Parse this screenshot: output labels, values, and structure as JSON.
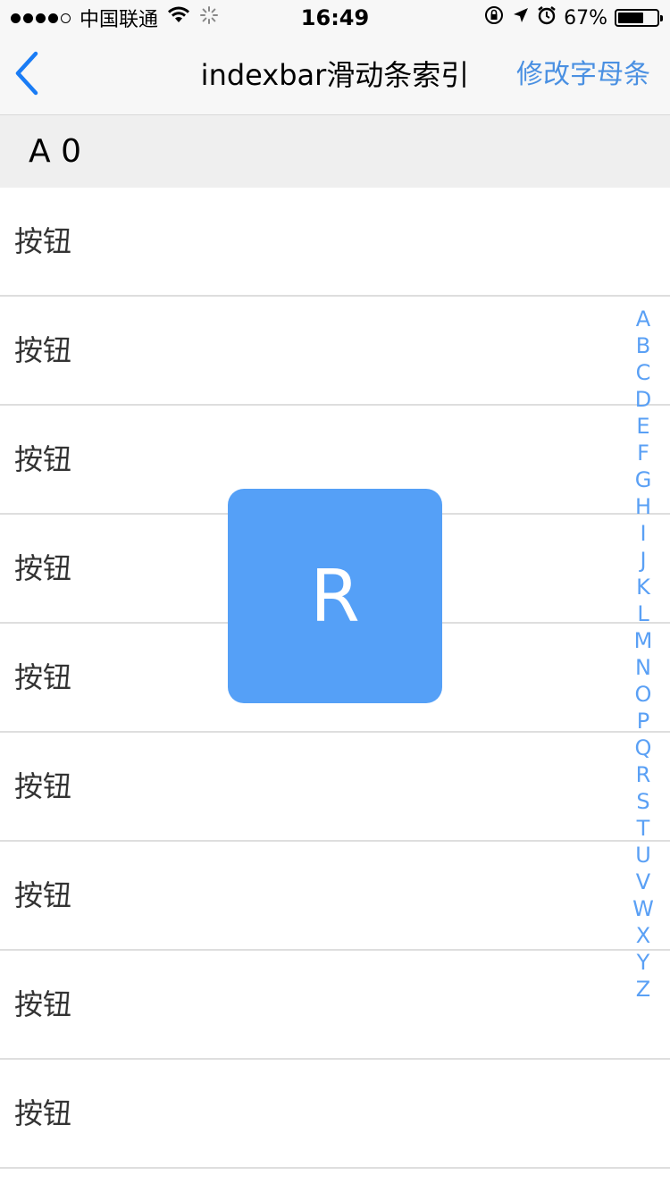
{
  "status_bar": {
    "carrier": "中国联通",
    "time": "16:49",
    "battery_percent": "67%",
    "battery_level": 0.67,
    "signal": {
      "filled": 4,
      "total": 5
    }
  },
  "nav": {
    "title": "indexbar滑动条索引",
    "right_label": "修改字母条"
  },
  "section": {
    "header": "A 0"
  },
  "list": {
    "items": [
      "按钮",
      "按钮",
      "按钮",
      "按钮",
      "按钮",
      "按钮",
      "按钮",
      "按钮",
      "按钮"
    ]
  },
  "index_bar": {
    "letters": [
      "A",
      "B",
      "C",
      "D",
      "E",
      "F",
      "G",
      "H",
      "I",
      "J",
      "K",
      "L",
      "M",
      "N",
      "O",
      "P",
      "Q",
      "R",
      "S",
      "T",
      "U",
      "V",
      "W",
      "X",
      "Y",
      "Z"
    ],
    "selected": "R"
  },
  "indicator": {
    "letter": "R"
  },
  "colors": {
    "accent": "#4a90e2",
    "indicator_bg": "#55a0f7",
    "index_letter": "#5aa0f5"
  },
  "icons": {
    "back": "chevron-left-icon",
    "wifi": "wifi-icon",
    "loading": "activity-spinner-icon",
    "rotation_lock": "rotation-lock-icon",
    "location": "location-arrow-icon",
    "alarm": "alarm-icon",
    "battery": "battery-icon"
  }
}
